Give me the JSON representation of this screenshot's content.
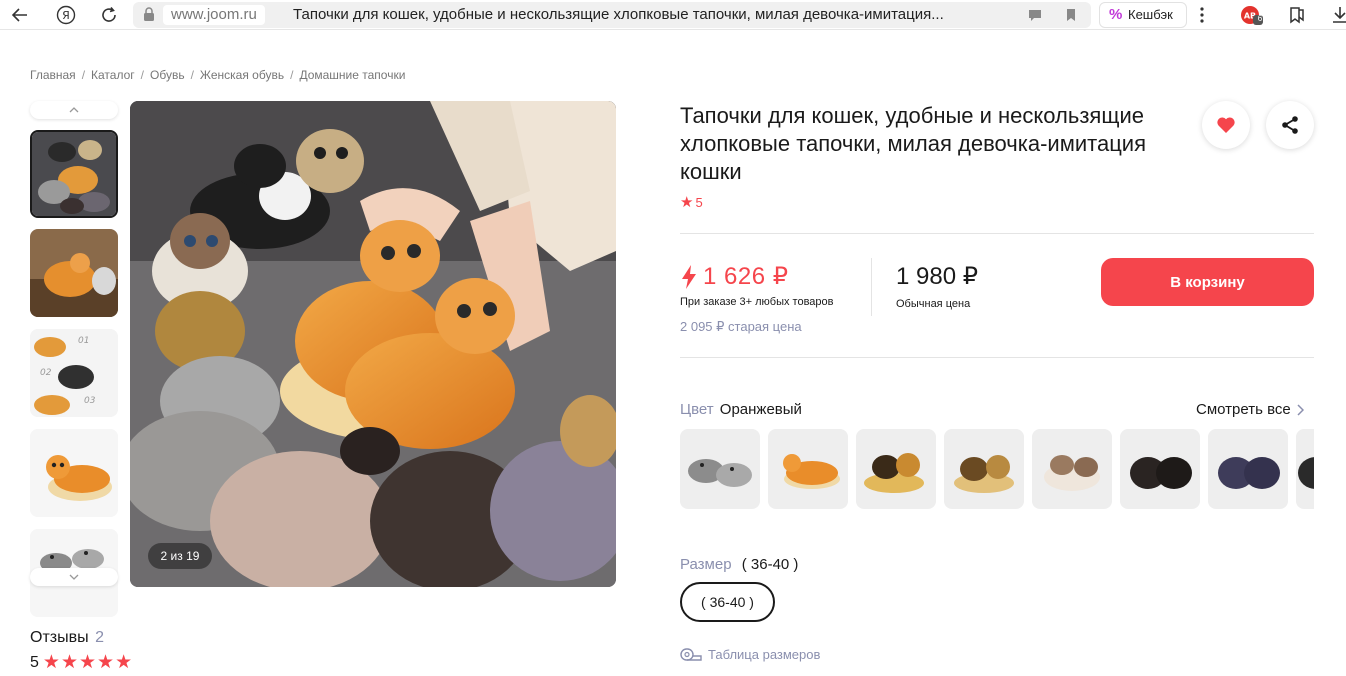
{
  "browser": {
    "domain": "www.joom.ru",
    "tab_title": "Тапочки для кошек, удобные и нескользящие хлопковые тапочки, милая девочка-имитация...",
    "cashback_label": "Кешбэк",
    "extension_badge": "6"
  },
  "breadcrumb": [
    "Главная",
    "Каталог",
    "Обувь",
    "Женская обувь",
    "Домашние тапочки"
  ],
  "gallery": {
    "counter": "2 из 19",
    "thumb_texts": [
      "01",
      "02",
      "03"
    ]
  },
  "reviews": {
    "title": "Отзывы",
    "count": "2",
    "rating": "5",
    "stars": 5
  },
  "product": {
    "title": "Тапочки для кошек, удобные и нескользящие хлопковые тапочки, милая девочка-имитация кошки",
    "rating": "5"
  },
  "price": {
    "sale": "1 626 ₽",
    "sale_note": "При заказе 3+ любых товаров",
    "old": "2 095 ₽ старая цена",
    "regular": "1 980 ₽",
    "regular_label": "Обычная цена",
    "cart_button": "В корзину"
  },
  "color": {
    "label": "Цвет",
    "value": "Оранжевый",
    "see_all": "Смотреть все"
  },
  "size": {
    "label": "Размер",
    "value": "( 36-40 )",
    "chip": "( 36-40 )",
    "table_link": "Таблица размеров"
  },
  "colors": {
    "accent": "#f5454c",
    "muted": "#8a8fae"
  }
}
